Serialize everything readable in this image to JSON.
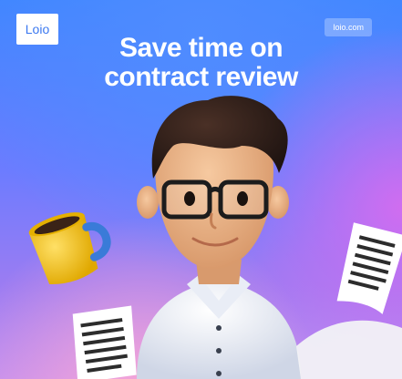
{
  "brand": {
    "logo_text": "Loio",
    "url_label": "loio.com"
  },
  "headline": {
    "line1": "Save time on",
    "line2": "contract review"
  },
  "colors": {
    "background_top": "#3f86ff",
    "background_bottom": "#c08ef0",
    "accent_pink": "#f7a6d6",
    "mug": "#f2c21b",
    "mug_handle": "#3a7bd8"
  },
  "illustration": {
    "character": "3d-man-with-glasses",
    "props": [
      "coffee-mug-icon",
      "document-icon",
      "document-icon"
    ]
  }
}
